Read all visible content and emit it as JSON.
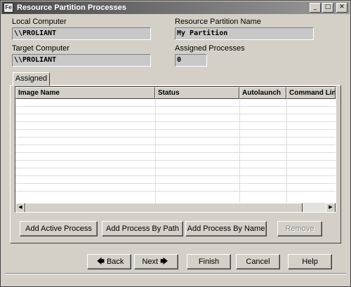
{
  "window": {
    "title": "Resource Partition Processes",
    "minimize": "_",
    "maximize": "□",
    "close": "✕"
  },
  "form": {
    "local_computer_label": "Local Computer",
    "local_computer_value": "\\\\PROLIANT",
    "partition_name_label": "Resource Partition Name",
    "partition_name_value": "My Partition",
    "target_computer_label": "Target Computer",
    "target_computer_value": "\\\\PROLIANT",
    "assigned_processes_label": "Assigned Processes",
    "assigned_processes_value": "0"
  },
  "tabs": [
    {
      "label": "Assigned",
      "active": true
    }
  ],
  "table": {
    "columns": [
      "Image Name",
      "Status",
      "Autolaunch",
      "Command Line"
    ],
    "rows": []
  },
  "actions": {
    "add_active_process": "Add Active Process",
    "add_process_by_path": "Add Process By Path",
    "add_process_by_name": "Add Process By Name",
    "remove": "Remove"
  },
  "wizard": {
    "back": "Back",
    "next": "Next",
    "finish": "Finish",
    "cancel": "Cancel",
    "help": "Help"
  },
  "icons": {
    "back_arrow": "arrow-left-icon",
    "next_arrow": "arrow-right-icon",
    "scroll_left": "scroll-left-icon",
    "scroll_right": "scroll-right-icon"
  }
}
